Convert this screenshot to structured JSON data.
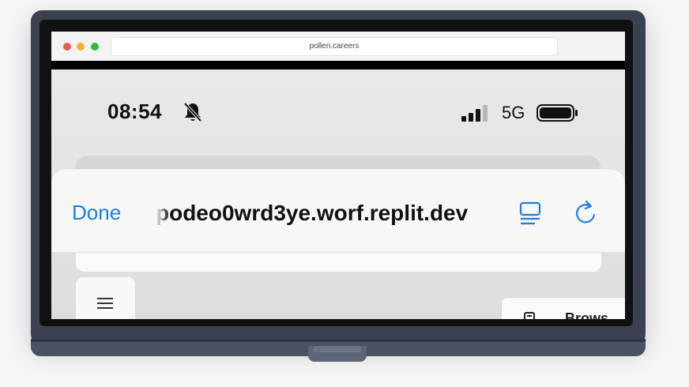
{
  "browser": {
    "address": "pollen.careers"
  },
  "status_bar": {
    "time": "08:54",
    "network": "5G",
    "icons": [
      "bell-slash-icon",
      "signal-icon",
      "battery-icon"
    ]
  },
  "sheet": {
    "done_label": "Done",
    "url": "podeo0wrd3ye.worf.replit.dev",
    "icons": [
      "reader-mode-icon",
      "reload-icon"
    ],
    "accent_color": "#1a7de3"
  },
  "page": {
    "browse_label": "Brows",
    "icons": [
      "hamburger-menu-icon",
      "document-icon"
    ]
  },
  "window_controls": {
    "colors": [
      "#ee5a52",
      "#f3b42c",
      "#2eb944"
    ]
  }
}
